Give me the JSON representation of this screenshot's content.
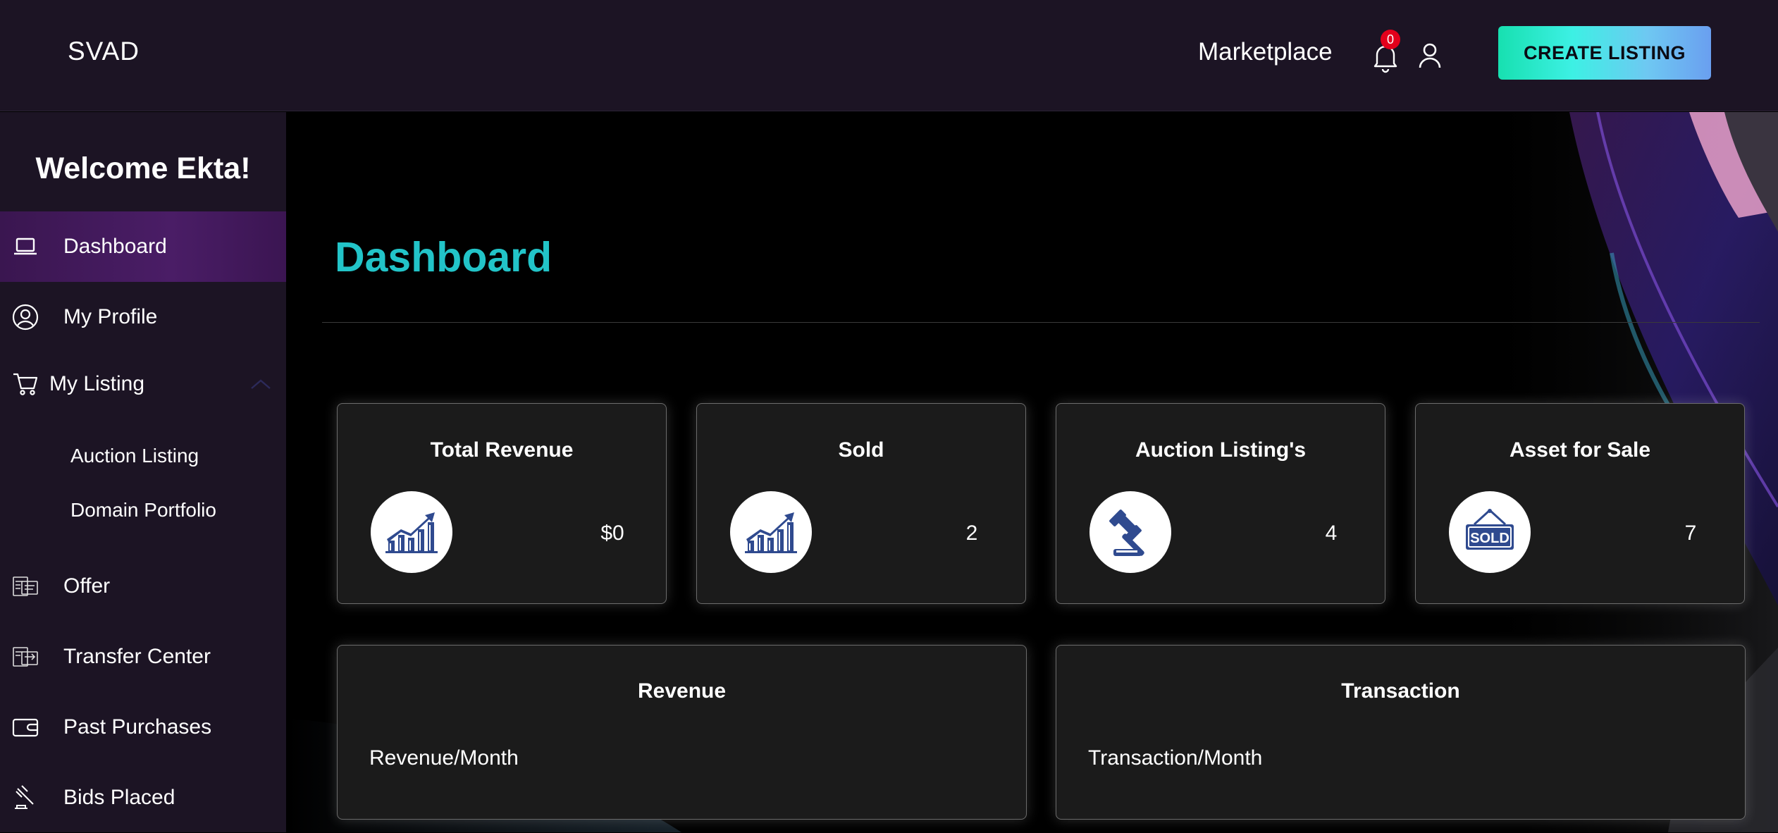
{
  "header": {
    "brand": "SVAD",
    "nav_marketplace": "Marketplace",
    "notification_count": "0",
    "create_listing_label": "CREATE LISTING"
  },
  "sidebar": {
    "welcome": "Welcome Ekta!",
    "items": [
      {
        "label": "Dashboard",
        "icon": "laptop-icon",
        "active": true
      },
      {
        "label": "My Profile",
        "icon": "user-circle-icon"
      },
      {
        "label": "My Listing",
        "icon": "cart-icon",
        "expanded": true,
        "children": [
          "Auction Listing",
          "Domain Portfolio"
        ]
      },
      {
        "label": "Offer",
        "icon": "offer-icon"
      },
      {
        "label": "Transfer Center",
        "icon": "transfer-icon"
      },
      {
        "label": "Past Purchases",
        "icon": "wallet-icon"
      },
      {
        "label": "Bids Placed",
        "icon": "gavel-icon"
      }
    ]
  },
  "main": {
    "title": "Dashboard",
    "stats": [
      {
        "title": "Total Revenue",
        "value": "$0",
        "icon": "growth-chart-icon"
      },
      {
        "title": "Sold",
        "value": "2",
        "icon": "growth-chart-icon"
      },
      {
        "title": "Auction Listing's",
        "value": "4",
        "icon": "auction-gavel-icon"
      },
      {
        "title": "Asset for Sale",
        "value": "7",
        "icon": "sold-sign-icon"
      }
    ],
    "panels": [
      {
        "title": "Revenue",
        "subtitle": "Revenue/Month"
      },
      {
        "title": "Transaction",
        "subtitle": "Transaction/Month"
      }
    ]
  },
  "colors": {
    "accent_title": "#22c4c8",
    "header_bg": "#1c1424",
    "active_item": "#4a1d66",
    "badge": "#e3001b",
    "icon_blue": "#2f4a8f"
  }
}
